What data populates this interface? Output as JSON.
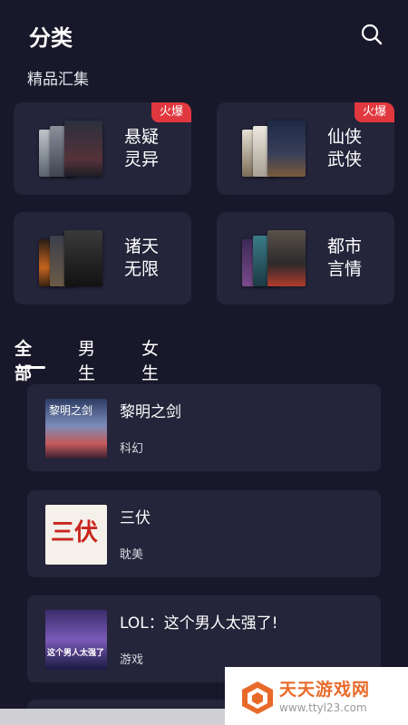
{
  "header": {
    "title": "分类",
    "search_icon": "search-icon"
  },
  "featured": {
    "title": "精品汇集",
    "cards": [
      {
        "label": "悬疑灵异",
        "line1": "悬疑",
        "line2": "灵异",
        "badge": "火爆"
      },
      {
        "label": "仙侠武侠",
        "line1": "仙侠",
        "line2": "武侠",
        "badge": "火爆"
      },
      {
        "label": "诸天无限",
        "line1": "诸天",
        "line2": "无限",
        "badge": ""
      },
      {
        "label": "都市言情",
        "line1": "都市",
        "line2": "言情",
        "badge": ""
      }
    ]
  },
  "tabs": [
    {
      "label": "全部",
      "active": true
    },
    {
      "label": "男生",
      "active": false
    },
    {
      "label": "女生",
      "active": false
    }
  ],
  "books": [
    {
      "title": "黎明之剑",
      "genre": "科幻",
      "cover_text": "黎明之剑"
    },
    {
      "title": "三伏",
      "genre": "耽美",
      "cover_text": "三伏"
    },
    {
      "title": "LOL：这个男人太强了!",
      "genre": "游戏",
      "cover_text": "这个男人太强了"
    }
  ],
  "watermark": {
    "name": "天天游戏网",
    "url": "www.ttyl23.com"
  },
  "colors": {
    "background": "#18182a",
    "card": "#24243a",
    "badge": "#e0383e",
    "watermark_text": "#e86a2a"
  }
}
